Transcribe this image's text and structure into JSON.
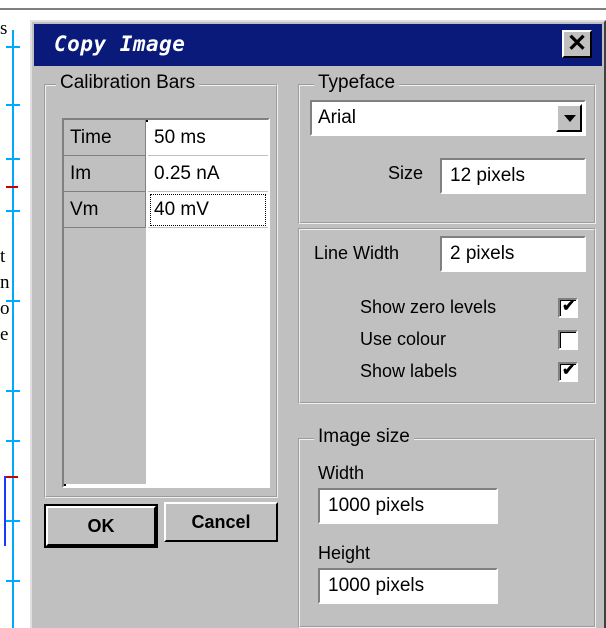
{
  "background": {
    "fragments": [
      "s",
      "t",
      "n",
      "o",
      "e"
    ]
  },
  "dialog": {
    "title": "Copy Image",
    "close_glyph": "✕"
  },
  "calibration": {
    "legend": "Calibration Bars",
    "rows": [
      {
        "name": "Time",
        "value": "50 ms"
      },
      {
        "name": "Im",
        "value": "0.25 nA"
      },
      {
        "name": "Vm",
        "value": "40 mV"
      }
    ]
  },
  "typeface": {
    "legend": "Typeface",
    "font_selected": "Arial",
    "size_label": "Size",
    "size_value": "12  pixels"
  },
  "lines": {
    "line_width_label": "Line Width",
    "line_width_value": "2  pixels",
    "options": [
      {
        "label": "Show zero levels",
        "checked": true
      },
      {
        "label": "Use colour",
        "checked": false
      },
      {
        "label": "Show labels",
        "checked": true
      }
    ]
  },
  "image_size": {
    "legend": "Image size",
    "width_label": "Width",
    "width_value": "1000  pixels",
    "height_label": "Height",
    "height_value": "1000 pixels"
  },
  "buttons": {
    "ok": "OK",
    "cancel": "Cancel"
  },
  "icons": {
    "close": "close-icon",
    "dropdown": "chevron-down-icon",
    "check": "checkmark-icon"
  }
}
